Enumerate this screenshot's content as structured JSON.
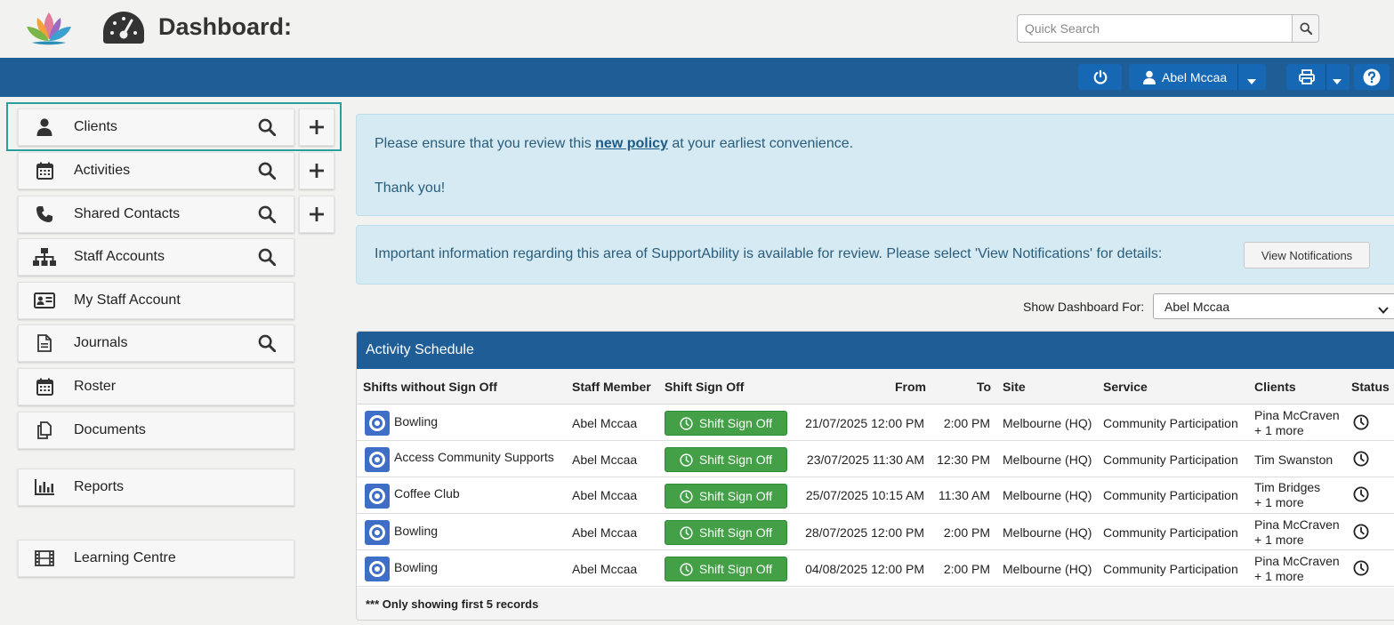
{
  "header": {
    "title": "Dashboard:",
    "search_placeholder": "Quick Search"
  },
  "topbar": {
    "user_name": "Abel Mccaa"
  },
  "sidebar": {
    "items": [
      {
        "label": "Clients",
        "icon": "user-icon",
        "has_search": true,
        "has_add": true,
        "highlighted": true
      },
      {
        "label": "Activities",
        "icon": "calendar-icon",
        "has_search": true,
        "has_add": true
      },
      {
        "label": "Shared Contacts",
        "icon": "phone-icon",
        "has_search": true,
        "has_add": true
      },
      {
        "label": "Staff Accounts",
        "icon": "org-chart-icon",
        "has_search": true
      },
      {
        "label": "My Staff Account",
        "icon": "id-card-icon"
      },
      {
        "label": "Journals",
        "icon": "document-icon",
        "has_search": true
      },
      {
        "label": "Roster",
        "icon": "calendar-icon"
      },
      {
        "label": "Documents",
        "icon": "copy-icon"
      },
      {
        "label": "Reports",
        "icon": "bar-chart-icon"
      },
      {
        "label": "Learning Centre",
        "icon": "film-icon"
      }
    ]
  },
  "alerts": {
    "policy": {
      "text_before": "Please ensure that you review this ",
      "link": "new policy",
      "text_after": " at your earliest convenience.",
      "thanks": "Thank you!"
    },
    "notifications": {
      "text": "Important information regarding this area of SupportAbility is available for review. Please select 'View Notifications' for details:",
      "button": "View Notifications"
    }
  },
  "dashboard_for": {
    "label": "Show Dashboard For:",
    "selected": "Abel Mccaa"
  },
  "schedule": {
    "title": "Activity Schedule",
    "columns": [
      "Shifts without Sign Off",
      "Staff Member",
      "Shift Sign Off",
      "From",
      "To",
      "Site",
      "Service",
      "Clients",
      "Status"
    ],
    "sign_off_label": "Shift Sign Off",
    "rows": [
      {
        "activity": "Bowling",
        "staff": "Abel Mccaa",
        "from": "21/07/2025 12:00 PM",
        "to": "2:00 PM",
        "site": "Melbourne (HQ)",
        "service": "Community Participation",
        "client": "Pina McCraven",
        "more": "+ 1 more"
      },
      {
        "activity": "Access Community Supports",
        "staff": "Abel Mccaa",
        "from": "23/07/2025 11:30 AM",
        "to": "12:30 PM",
        "site": "Melbourne (HQ)",
        "service": "Community Participation",
        "client": "Tim Swanston",
        "more": ""
      },
      {
        "activity": "Coffee Club",
        "staff": "Abel Mccaa",
        "from": "25/07/2025 10:15 AM",
        "to": "11:30 AM",
        "site": "Melbourne (HQ)",
        "service": "Community Participation",
        "client": "Tim Bridges",
        "more": "+ 1 more"
      },
      {
        "activity": "Bowling",
        "staff": "Abel Mccaa",
        "from": "28/07/2025 12:00 PM",
        "to": "2:00 PM",
        "site": "Melbourne (HQ)",
        "service": "Community Participation",
        "client": "Pina McCraven",
        "more": "+ 1 more"
      },
      {
        "activity": "Bowling",
        "staff": "Abel Mccaa",
        "from": "04/08/2025 12:00 PM",
        "to": "2:00 PM",
        "site": "Melbourne (HQ)",
        "service": "Community Participation",
        "client": "Pina McCraven",
        "more": "+ 1 more"
      }
    ],
    "footer": "*** Only showing first 5 records"
  },
  "colors": {
    "brand_blue": "#1f5d96",
    "button_blue": "#1668b4",
    "sign_off_green": "#43a047",
    "info_bg": "#d6eaf3",
    "highlight": "#2a9d9d"
  }
}
